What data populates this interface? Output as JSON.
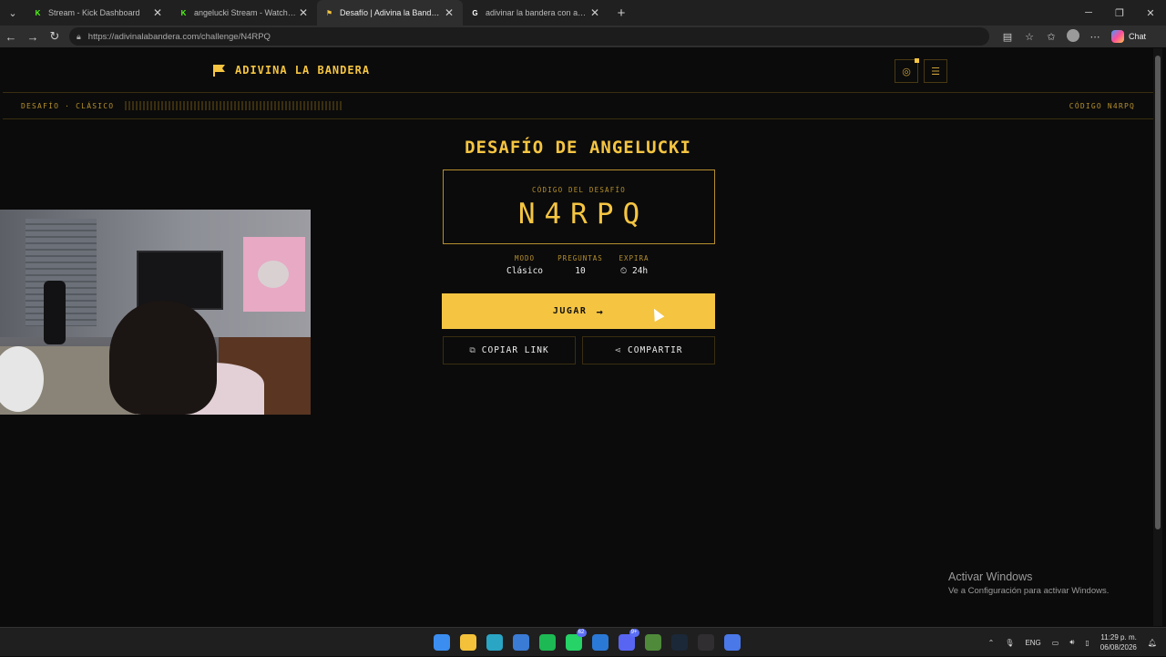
{
  "browser": {
    "tabs": [
      {
        "title": "Stream - Kick Dashboard",
        "fav_color": "#53fc18",
        "fav_text": "K",
        "active": false
      },
      {
        "title": "angelucki Stream - Watch Live on Kick",
        "fav_color": "#53fc18",
        "fav_text": "K",
        "active": false
      },
      {
        "title": "Desafío | Adivina la Bandera",
        "fav_color": "#f5c542",
        "fav_text": "⚑",
        "active": true
      },
      {
        "title": "adivinar la bandera con amigos - Buscar con Google",
        "fav_color": "#ffffff",
        "fav_text": "G",
        "active": false
      }
    ],
    "url": "https://adivinalabandera.com/challenge/N4RPQ",
    "chat_label": "Chat"
  },
  "header": {
    "logo_text": "ADIVINA LA BANDERA"
  },
  "strip": {
    "left_text": "DESAFÍO · CLÁSICO",
    "right_text": "CÓDIGO N4RPQ"
  },
  "challenge": {
    "title": "DESAFÍO DE ANGELUCKI",
    "code_label": "CÓDIGO DEL DESAFÍO",
    "code": "N4RPQ",
    "meta": [
      {
        "key": "MODO",
        "value": "Clásico"
      },
      {
        "key": "PREGUNTAS",
        "value": "10"
      },
      {
        "key": "EXPIRA",
        "value": "⏲ 24h"
      }
    ],
    "play_label": "JUGAR",
    "copy_label": "COPIAR LINK",
    "share_label": "COMPARTIR"
  },
  "watermark": {
    "line1": "Activar Windows",
    "line2": "Ve a Configuración para activar Windows."
  },
  "taskbar": {
    "apps": [
      {
        "name": "windows-start",
        "color": "#3b8ef0"
      },
      {
        "name": "file-explorer",
        "color": "#f3c13a"
      },
      {
        "name": "edge",
        "color": "#2aa5c4"
      },
      {
        "name": "store",
        "color": "#3a7bd5"
      },
      {
        "name": "spotify",
        "color": "#1db954"
      },
      {
        "name": "whatsapp",
        "color": "#25d366",
        "badge": "62"
      },
      {
        "name": "outlook",
        "color": "#2b79d6"
      },
      {
        "name": "discord",
        "color": "#5865f2",
        "badge": "9+"
      },
      {
        "name": "minecraft",
        "color": "#4f8a3a"
      },
      {
        "name": "steam",
        "color": "#1b2838"
      },
      {
        "name": "obs",
        "color": "#302e31"
      },
      {
        "name": "notes",
        "color": "#4a78e8"
      }
    ],
    "lang": "ENG",
    "time": "11:29 p. m.",
    "date": "06/08/2026"
  }
}
